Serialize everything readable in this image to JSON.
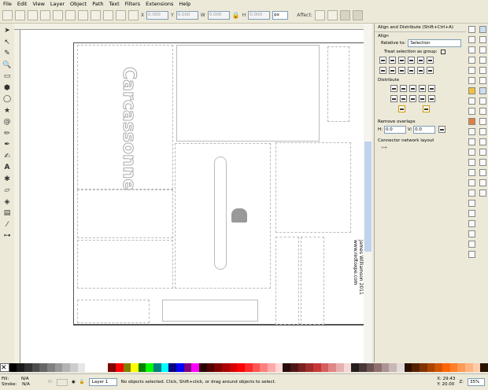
{
  "menu": [
    "File",
    "Edit",
    "View",
    "Layer",
    "Object",
    "Path",
    "Text",
    "Filters",
    "Extensions",
    "Help"
  ],
  "toolbar": {
    "x": "0.000",
    "y": "0.000",
    "w": "0.000",
    "h": "0.000",
    "unit": "px",
    "affect_label": "Affect:"
  },
  "canvas": {
    "credit_line1": "James Williamson 2011",
    "credit_line2": "www.redtoxpe.com",
    "logo_text": "Carcassonne"
  },
  "dock": {
    "title": "Align and Distribute (Shift+Ctrl+A)",
    "align_label": "Align",
    "relative_to_label": "Relative to:",
    "relative_to_value": "Selection",
    "treat_group_label": "Treat selection as group:",
    "distribute_label": "Distribute",
    "remove_overlaps_label": "Remove overlaps",
    "h_label": "H:",
    "h_value": "0.0",
    "v_label": "V:",
    "v_value": "0.0",
    "connector_label": "Connector network layout"
  },
  "palette": [
    "#ffffff",
    "#000000",
    "#1a1a1a",
    "#333",
    "#4d4d4d",
    "#666",
    "#808080",
    "#999",
    "#b3b3b3",
    "#ccc",
    "#e6e6e6",
    "#fff",
    "#fff",
    "#fff",
    "#800000",
    "#ff0000",
    "#808000",
    "#ffff00",
    "#008000",
    "#00ff00",
    "#008080",
    "#00ffff",
    "#000080",
    "#0000ff",
    "#800080",
    "#ff00ff",
    "#2b0000",
    "#550000",
    "#800000",
    "#aa0000",
    "#d40000",
    "#ff0000",
    "#ff2a2a",
    "#ff5555",
    "#ff8080",
    "#ffaaaa",
    "#ffd5d5",
    "#280b0b",
    "#501616",
    "#782121",
    "#a02c2c",
    "#c83737",
    "#d35f5f",
    "#de8787",
    "#e9afaf",
    "#f4d7d7",
    "#241c1c",
    "#483737",
    "#6c5353",
    "#916f6f",
    "#ac9393",
    "#c8b7b7",
    "#e3dbdb",
    "#2b1100",
    "#552200",
    "#803300",
    "#aa4400",
    "#d45500",
    "#ff6600",
    "#ff7f2a",
    "#ff9955",
    "#ffb380",
    "#ffccaa",
    "#2b1100"
  ],
  "status": {
    "fill_label": "Fill:",
    "fill_value": "N/A",
    "stroke_label": "Stroke:",
    "stroke_value": "N/A",
    "opacity_label": "O:",
    "layer": "Layer 1",
    "message": "No objects selected. Click, Shift+click, or drag around objects to select.",
    "x_label": "X:",
    "x_value": "29.43",
    "y_label": "Y:",
    "y_value": "20.00",
    "zoom_label": "Z:",
    "zoom_value": "35%"
  }
}
